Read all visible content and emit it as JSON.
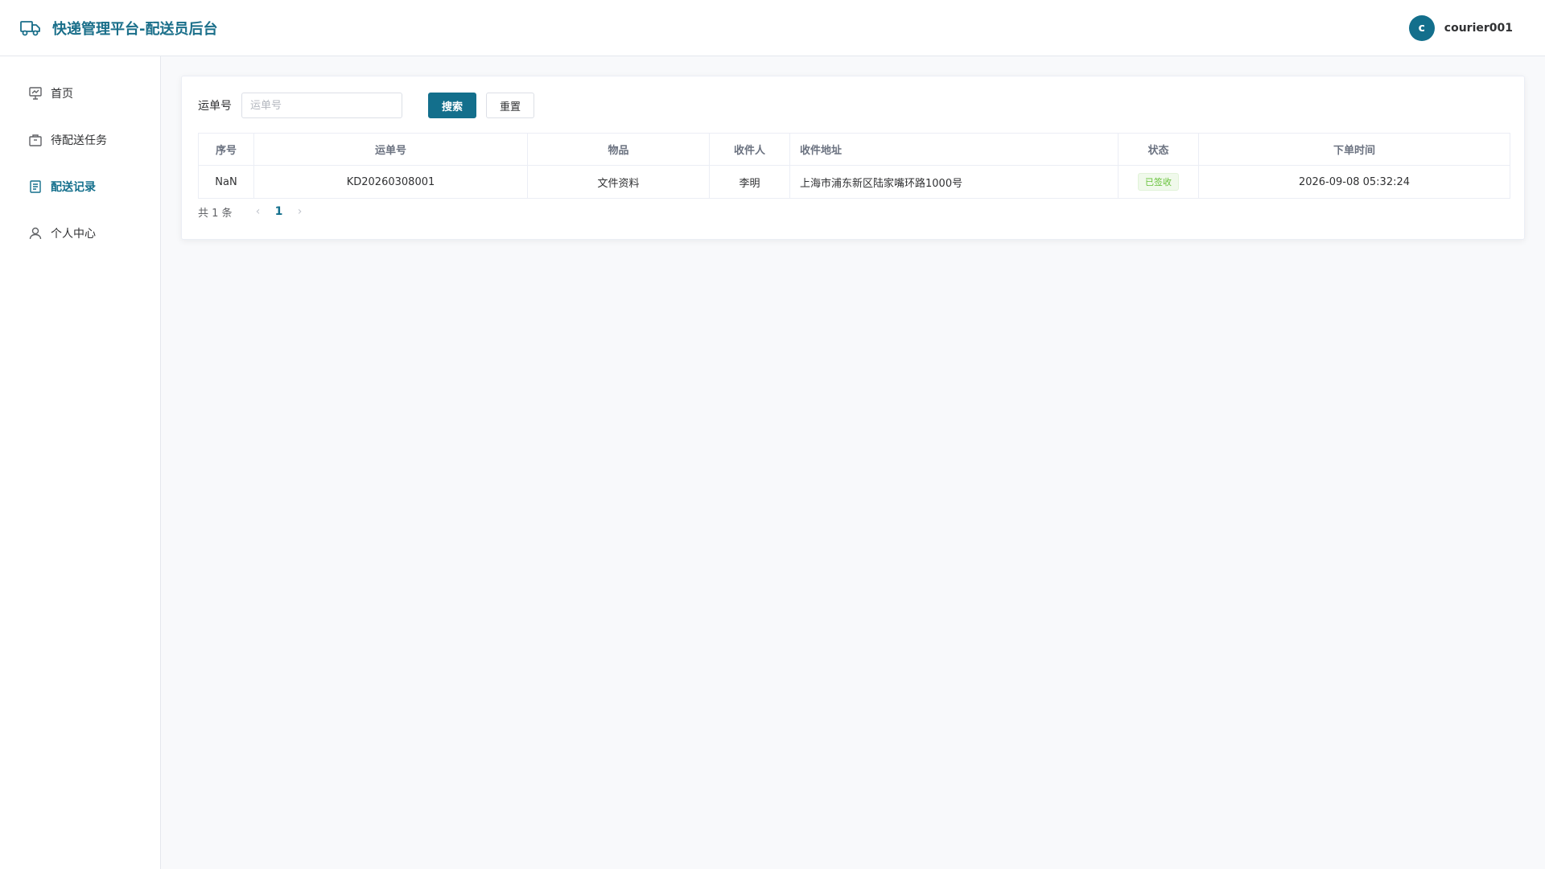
{
  "header": {
    "title": "快递管理平台-配送员后台",
    "avatar_letter": "c",
    "username": "courier001"
  },
  "sidebar": {
    "items": [
      {
        "label": "首页",
        "icon": "chart-board-icon"
      },
      {
        "label": "待配送任务",
        "icon": "package-icon"
      },
      {
        "label": "配送记录",
        "icon": "document-icon",
        "active": true
      },
      {
        "label": "个人中心",
        "icon": "user-icon"
      }
    ]
  },
  "search": {
    "label": "运单号",
    "placeholder": "运单号",
    "value": "",
    "search_button": "搜索",
    "reset_button": "重置"
  },
  "table": {
    "columns": [
      "序号",
      "运单号",
      "物品",
      "收件人",
      "收件地址",
      "状态",
      "下单时间"
    ],
    "rows": [
      {
        "index": "NaN",
        "tracking_no": "KD20260308001",
        "item": "文件资料",
        "recipient": "李明",
        "address": "上海市浦东新区陆家嘴环路1000号",
        "status": "已签收",
        "order_time": "2026-09-08 05:32:24"
      }
    ]
  },
  "pagination": {
    "total_text": "共 1 条",
    "current_page": "1",
    "prev_symbol": "‹",
    "next_symbol": "›"
  },
  "colors": {
    "primary": "#136f8c",
    "success": "#67c23a"
  }
}
